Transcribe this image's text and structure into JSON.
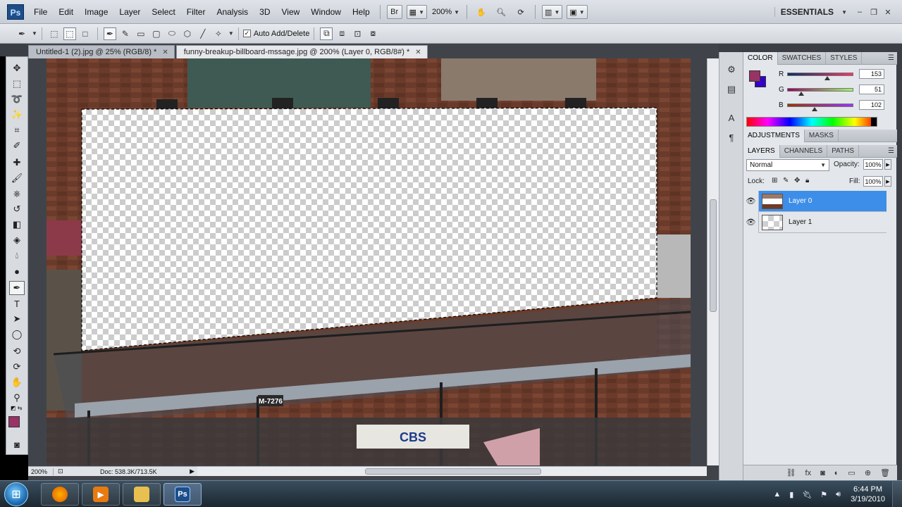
{
  "app": {
    "logo_text": "Ps"
  },
  "menu": [
    "File",
    "Edit",
    "Image",
    "Layer",
    "Select",
    "Filter",
    "Analysis",
    "3D",
    "View",
    "Window",
    "Help"
  ],
  "menubar": {
    "zoom": "200%",
    "workspace": "ESSENTIALS"
  },
  "options": {
    "auto_add_delete": "Auto Add/Delete",
    "auto_add_checked": true
  },
  "tabs": [
    {
      "label": "Untitled-1 (2).jpg @ 25% (RGB/8) *",
      "active": false
    },
    {
      "label": "funny-breakup-billboard-mssage.jpg @ 200% (Layer 0, RGB/8#) *",
      "active": true
    }
  ],
  "scene": {
    "sign_plate": "M-7276",
    "cbs_sign": "CBS"
  },
  "status": {
    "zoom": "200%",
    "doc": "Doc: 538.3K/713.5K"
  },
  "color_panel": {
    "tabs": [
      "COLOR",
      "SWATCHES",
      "STYLES"
    ],
    "r": {
      "label": "R",
      "value": "153",
      "level": 0.6
    },
    "g": {
      "label": "G",
      "value": "51",
      "level": 0.2
    },
    "b": {
      "label": "B",
      "value": "102",
      "level": 0.4
    },
    "foreground": "#993366",
    "background": "#3300cc"
  },
  "adjust_panel": {
    "tabs": [
      "ADJUSTMENTS",
      "MASKS"
    ]
  },
  "layers_panel": {
    "tabs": [
      "LAYERS",
      "CHANNELS",
      "PATHS"
    ],
    "blend_mode": "Normal",
    "opacity_label": "Opacity:",
    "opacity": "100%",
    "lock_label": "Lock:",
    "fill_label": "Fill:",
    "fill": "100%",
    "layers": [
      {
        "name": "Layer 0",
        "selected": true
      },
      {
        "name": "Layer 1",
        "selected": false
      }
    ]
  },
  "taskbar": {
    "time": "6:44 PM",
    "date": "3/19/2010",
    "ps_label": "Ps"
  },
  "colors": {
    "selection_blue": "#3d8ee8",
    "brand": "#1c4e8a"
  }
}
